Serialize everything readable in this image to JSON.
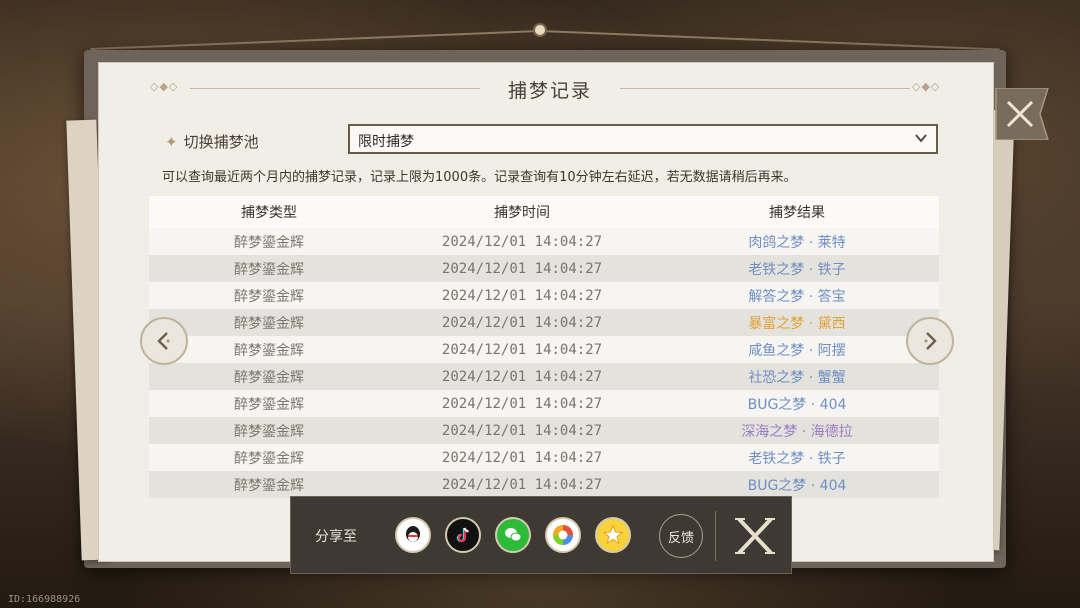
{
  "dialog": {
    "title": "捕梦记录",
    "pool_label": "切换捕梦池",
    "pool_selected": "限时捕梦",
    "notice": "可以查询最近两个月内的捕梦记录，记录上限为1000条。记录查询有10分钟左右延迟，若无数据请稍后再来。"
  },
  "table": {
    "headers": [
      "捕梦类型",
      "捕梦时间",
      "捕梦结果"
    ],
    "rows": [
      {
        "type": "醉梦鎏金辉",
        "time": "2024/12/01 14:04:27",
        "result": "肉鸽之梦 · 莱特",
        "color": "#6f8fc4"
      },
      {
        "type": "醉梦鎏金辉",
        "time": "2024/12/01 14:04:27",
        "result": "老铁之梦 · 铁子",
        "color": "#6f8fc4"
      },
      {
        "type": "醉梦鎏金辉",
        "time": "2024/12/01 14:04:27",
        "result": "解答之梦 · 答宝",
        "color": "#6f8fc4"
      },
      {
        "type": "醉梦鎏金辉",
        "time": "2024/12/01 14:04:27",
        "result": "暴富之梦 · 黛西",
        "color": "#e0a33a"
      },
      {
        "type": "醉梦鎏金辉",
        "time": "2024/12/01 14:04:27",
        "result": "咸鱼之梦 · 阿摆",
        "color": "#6f8fc4"
      },
      {
        "type": "醉梦鎏金辉",
        "time": "2024/12/01 14:04:27",
        "result": "社恐之梦 · 蟹蟹",
        "color": "#6f8fc4"
      },
      {
        "type": "醉梦鎏金辉",
        "time": "2024/12/01 14:04:27",
        "result": "BUG之梦 · 404",
        "color": "#6f8fc4"
      },
      {
        "type": "醉梦鎏金辉",
        "time": "2024/12/01 14:04:27",
        "result": "深海之梦 · 海德拉",
        "color": "#9a7cc4"
      },
      {
        "type": "醉梦鎏金辉",
        "time": "2024/12/01 14:04:27",
        "result": "老铁之梦 · 铁子",
        "color": "#6f8fc4"
      },
      {
        "type": "醉梦鎏金辉",
        "time": "2024/12/01 14:04:27",
        "result": "BUG之梦 · 404",
        "color": "#6f8fc4"
      }
    ]
  },
  "share": {
    "label": "分享至",
    "feedback_label": "反馈",
    "icons": [
      "qq-icon",
      "tiktok-icon",
      "wechat-icon",
      "moments-icon",
      "qzone-icon"
    ]
  },
  "footer": {
    "id_text": "ID:166988926"
  },
  "colors": {
    "accent_gold": "#e0a33a",
    "result_blue": "#6f8fc4",
    "result_purple": "#9a7cc4"
  }
}
